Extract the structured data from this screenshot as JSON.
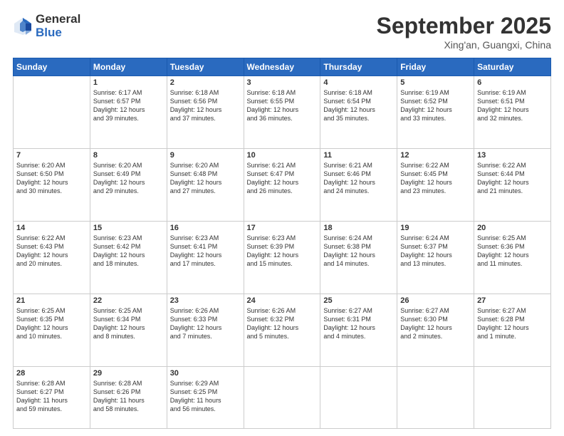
{
  "header": {
    "logo_general": "General",
    "logo_blue": "Blue",
    "month": "September 2025",
    "location": "Xing'an, Guangxi, China"
  },
  "weekdays": [
    "Sunday",
    "Monday",
    "Tuesday",
    "Wednesday",
    "Thursday",
    "Friday",
    "Saturday"
  ],
  "weeks": [
    [
      {
        "day": "",
        "info": ""
      },
      {
        "day": "1",
        "info": "Sunrise: 6:17 AM\nSunset: 6:57 PM\nDaylight: 12 hours\nand 39 minutes."
      },
      {
        "day": "2",
        "info": "Sunrise: 6:18 AM\nSunset: 6:56 PM\nDaylight: 12 hours\nand 37 minutes."
      },
      {
        "day": "3",
        "info": "Sunrise: 6:18 AM\nSunset: 6:55 PM\nDaylight: 12 hours\nand 36 minutes."
      },
      {
        "day": "4",
        "info": "Sunrise: 6:18 AM\nSunset: 6:54 PM\nDaylight: 12 hours\nand 35 minutes."
      },
      {
        "day": "5",
        "info": "Sunrise: 6:19 AM\nSunset: 6:52 PM\nDaylight: 12 hours\nand 33 minutes."
      },
      {
        "day": "6",
        "info": "Sunrise: 6:19 AM\nSunset: 6:51 PM\nDaylight: 12 hours\nand 32 minutes."
      }
    ],
    [
      {
        "day": "7",
        "info": "Sunrise: 6:20 AM\nSunset: 6:50 PM\nDaylight: 12 hours\nand 30 minutes."
      },
      {
        "day": "8",
        "info": "Sunrise: 6:20 AM\nSunset: 6:49 PM\nDaylight: 12 hours\nand 29 minutes."
      },
      {
        "day": "9",
        "info": "Sunrise: 6:20 AM\nSunset: 6:48 PM\nDaylight: 12 hours\nand 27 minutes."
      },
      {
        "day": "10",
        "info": "Sunrise: 6:21 AM\nSunset: 6:47 PM\nDaylight: 12 hours\nand 26 minutes."
      },
      {
        "day": "11",
        "info": "Sunrise: 6:21 AM\nSunset: 6:46 PM\nDaylight: 12 hours\nand 24 minutes."
      },
      {
        "day": "12",
        "info": "Sunrise: 6:22 AM\nSunset: 6:45 PM\nDaylight: 12 hours\nand 23 minutes."
      },
      {
        "day": "13",
        "info": "Sunrise: 6:22 AM\nSunset: 6:44 PM\nDaylight: 12 hours\nand 21 minutes."
      }
    ],
    [
      {
        "day": "14",
        "info": "Sunrise: 6:22 AM\nSunset: 6:43 PM\nDaylight: 12 hours\nand 20 minutes."
      },
      {
        "day": "15",
        "info": "Sunrise: 6:23 AM\nSunset: 6:42 PM\nDaylight: 12 hours\nand 18 minutes."
      },
      {
        "day": "16",
        "info": "Sunrise: 6:23 AM\nSunset: 6:41 PM\nDaylight: 12 hours\nand 17 minutes."
      },
      {
        "day": "17",
        "info": "Sunrise: 6:23 AM\nSunset: 6:39 PM\nDaylight: 12 hours\nand 15 minutes."
      },
      {
        "day": "18",
        "info": "Sunrise: 6:24 AM\nSunset: 6:38 PM\nDaylight: 12 hours\nand 14 minutes."
      },
      {
        "day": "19",
        "info": "Sunrise: 6:24 AM\nSunset: 6:37 PM\nDaylight: 12 hours\nand 13 minutes."
      },
      {
        "day": "20",
        "info": "Sunrise: 6:25 AM\nSunset: 6:36 PM\nDaylight: 12 hours\nand 11 minutes."
      }
    ],
    [
      {
        "day": "21",
        "info": "Sunrise: 6:25 AM\nSunset: 6:35 PM\nDaylight: 12 hours\nand 10 minutes."
      },
      {
        "day": "22",
        "info": "Sunrise: 6:25 AM\nSunset: 6:34 PM\nDaylight: 12 hours\nand 8 minutes."
      },
      {
        "day": "23",
        "info": "Sunrise: 6:26 AM\nSunset: 6:33 PM\nDaylight: 12 hours\nand 7 minutes."
      },
      {
        "day": "24",
        "info": "Sunrise: 6:26 AM\nSunset: 6:32 PM\nDaylight: 12 hours\nand 5 minutes."
      },
      {
        "day": "25",
        "info": "Sunrise: 6:27 AM\nSunset: 6:31 PM\nDaylight: 12 hours\nand 4 minutes."
      },
      {
        "day": "26",
        "info": "Sunrise: 6:27 AM\nSunset: 6:30 PM\nDaylight: 12 hours\nand 2 minutes."
      },
      {
        "day": "27",
        "info": "Sunrise: 6:27 AM\nSunset: 6:28 PM\nDaylight: 12 hours\nand 1 minute."
      }
    ],
    [
      {
        "day": "28",
        "info": "Sunrise: 6:28 AM\nSunset: 6:27 PM\nDaylight: 11 hours\nand 59 minutes."
      },
      {
        "day": "29",
        "info": "Sunrise: 6:28 AM\nSunset: 6:26 PM\nDaylight: 11 hours\nand 58 minutes."
      },
      {
        "day": "30",
        "info": "Sunrise: 6:29 AM\nSunset: 6:25 PM\nDaylight: 11 hours\nand 56 minutes."
      },
      {
        "day": "",
        "info": ""
      },
      {
        "day": "",
        "info": ""
      },
      {
        "day": "",
        "info": ""
      },
      {
        "day": "",
        "info": ""
      }
    ]
  ]
}
